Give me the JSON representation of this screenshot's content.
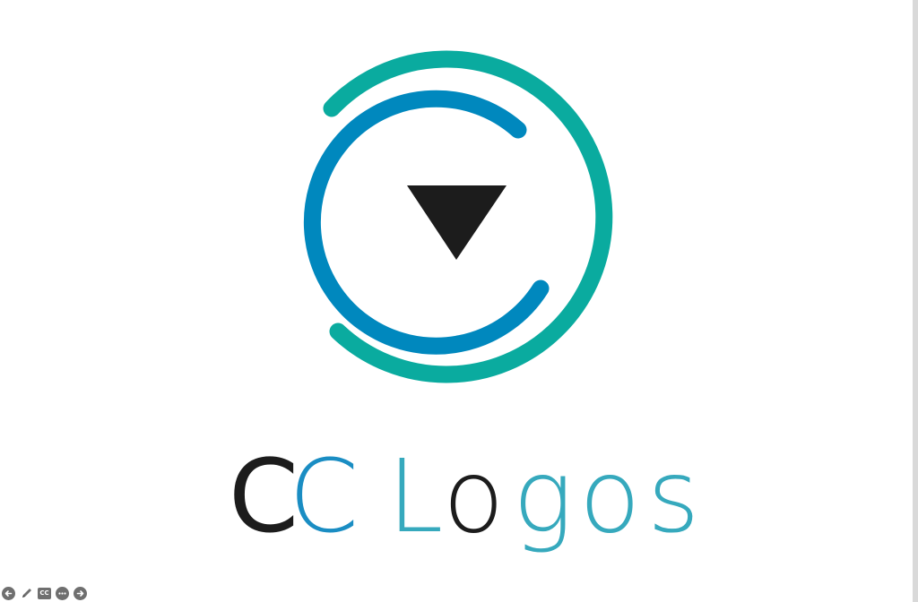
{
  "logo": {
    "word_c1": "C",
    "word_c2": "C",
    "word_l": "L",
    "word_o1": "o",
    "word_g": "g",
    "word_o2": "o",
    "word_s": "s"
  },
  "colors": {
    "outer_ring": "#0aab9f",
    "inner_ring": "#0088be",
    "play_triangle": "#1c1c1c",
    "text_black": "#1c1c1c",
    "text_blue": "#1a8dc3",
    "text_teal": "#36a9bd",
    "control_grey": "#6f6f6f"
  },
  "controls": {
    "prev_icon": "arrow-left-icon",
    "pen_icon": "pencil-icon",
    "cc_label": "CC",
    "more_icon": "more-icon",
    "next_icon": "arrow-right-icon"
  }
}
